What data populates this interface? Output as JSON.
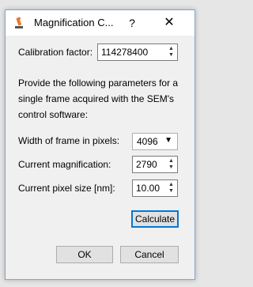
{
  "window": {
    "title": "Magnification C...",
    "help_label": "?",
    "close_label": "✕"
  },
  "calibration": {
    "label": "Calibration factor:",
    "value": "114278400"
  },
  "instructions": "Provide the following parameters for a single frame acquired with the SEM's control software:",
  "frame_width": {
    "label": "Width of frame in pixels:",
    "value": "4096"
  },
  "magnification": {
    "label": "Current magnification:",
    "value": "2790"
  },
  "pixel_size": {
    "label": "Current pixel size [nm]:",
    "value": "10.00"
  },
  "buttons": {
    "calculate": "Calculate",
    "ok": "OK",
    "cancel": "Cancel"
  },
  "icons": {
    "app": "microscope-icon",
    "help": "help-icon",
    "close": "close-icon",
    "spin_up": "▲",
    "spin_down": "▼",
    "dropdown": "▼"
  },
  "colors": {
    "accent": "#0078d7",
    "app_icon": "#e8772e"
  }
}
